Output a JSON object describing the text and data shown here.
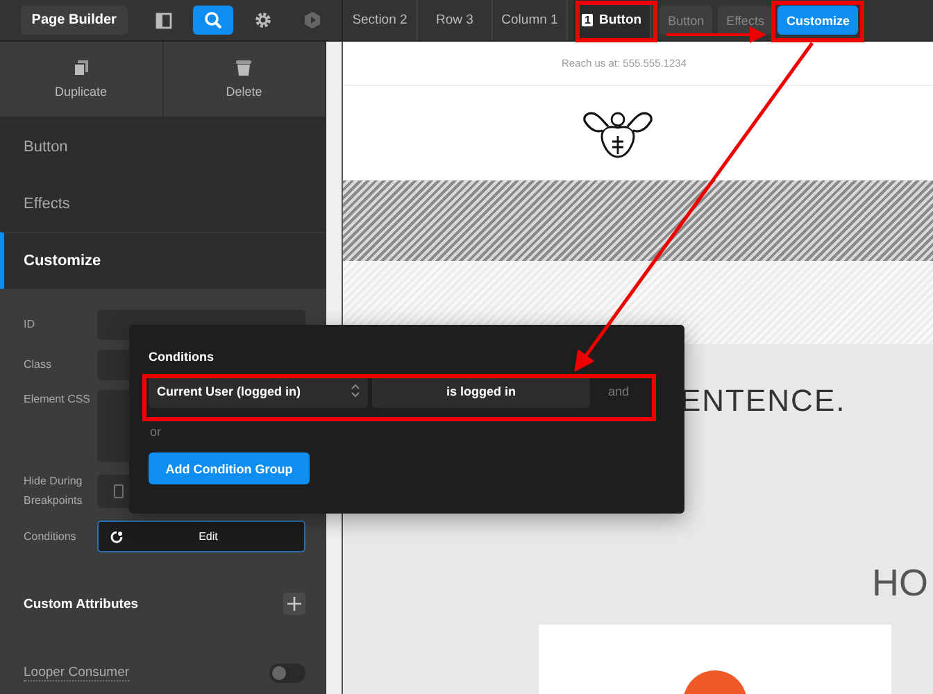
{
  "toolbar": {
    "title": "Page Builder",
    "tools": [
      {
        "kind": "panel",
        "selected": false
      },
      {
        "kind": "search",
        "selected": true
      },
      {
        "kind": "settings",
        "selected": false
      },
      {
        "kind": "plugin",
        "selected": false
      }
    ]
  },
  "breadcrumbs": [
    {
      "label": "Section 2"
    },
    {
      "label": "Row 3"
    },
    {
      "label": "Column 1"
    },
    {
      "label": "Button",
      "badge": "1"
    }
  ],
  "mode_tabs": [
    {
      "label": "Button",
      "selected": false
    },
    {
      "label": "Effects",
      "selected": false
    },
    {
      "label": "Customize",
      "selected": true
    }
  ],
  "sidebar": {
    "actions": [
      {
        "kind": "duplicate",
        "label": "Duplicate"
      },
      {
        "kind": "delete",
        "label": "Delete"
      }
    ],
    "sections": [
      {
        "label": "Button",
        "selected": false
      },
      {
        "label": "Effects",
        "selected": false
      },
      {
        "label": "Customize",
        "selected": true
      }
    ],
    "fields": [
      {
        "kind": "text",
        "label": "ID"
      },
      {
        "kind": "text",
        "label": "Class"
      },
      {
        "kind": "textarea",
        "label": "Element CSS"
      },
      {
        "kind": "breakpoints",
        "label": "Hide During Breakpoints"
      },
      {
        "kind": "conditions",
        "label": "Conditions",
        "button": "Edit"
      }
    ],
    "custom_attributes": {
      "label": "Custom Attributes"
    },
    "looper_consumer": {
      "label": "Looper Consumer",
      "on": false
    }
  },
  "conditions_popup": {
    "title": "Conditions",
    "rows": [
      {
        "subject": "Current User (logged in)",
        "operator": "is logged in",
        "joiner": "and"
      }
    ],
    "separator": "or",
    "add_button": "Add Condition Group"
  },
  "preview": {
    "contact": "Reach us at: 555.555.1234",
    "heading": "ENTENCE.",
    "subheading": "HO"
  }
}
